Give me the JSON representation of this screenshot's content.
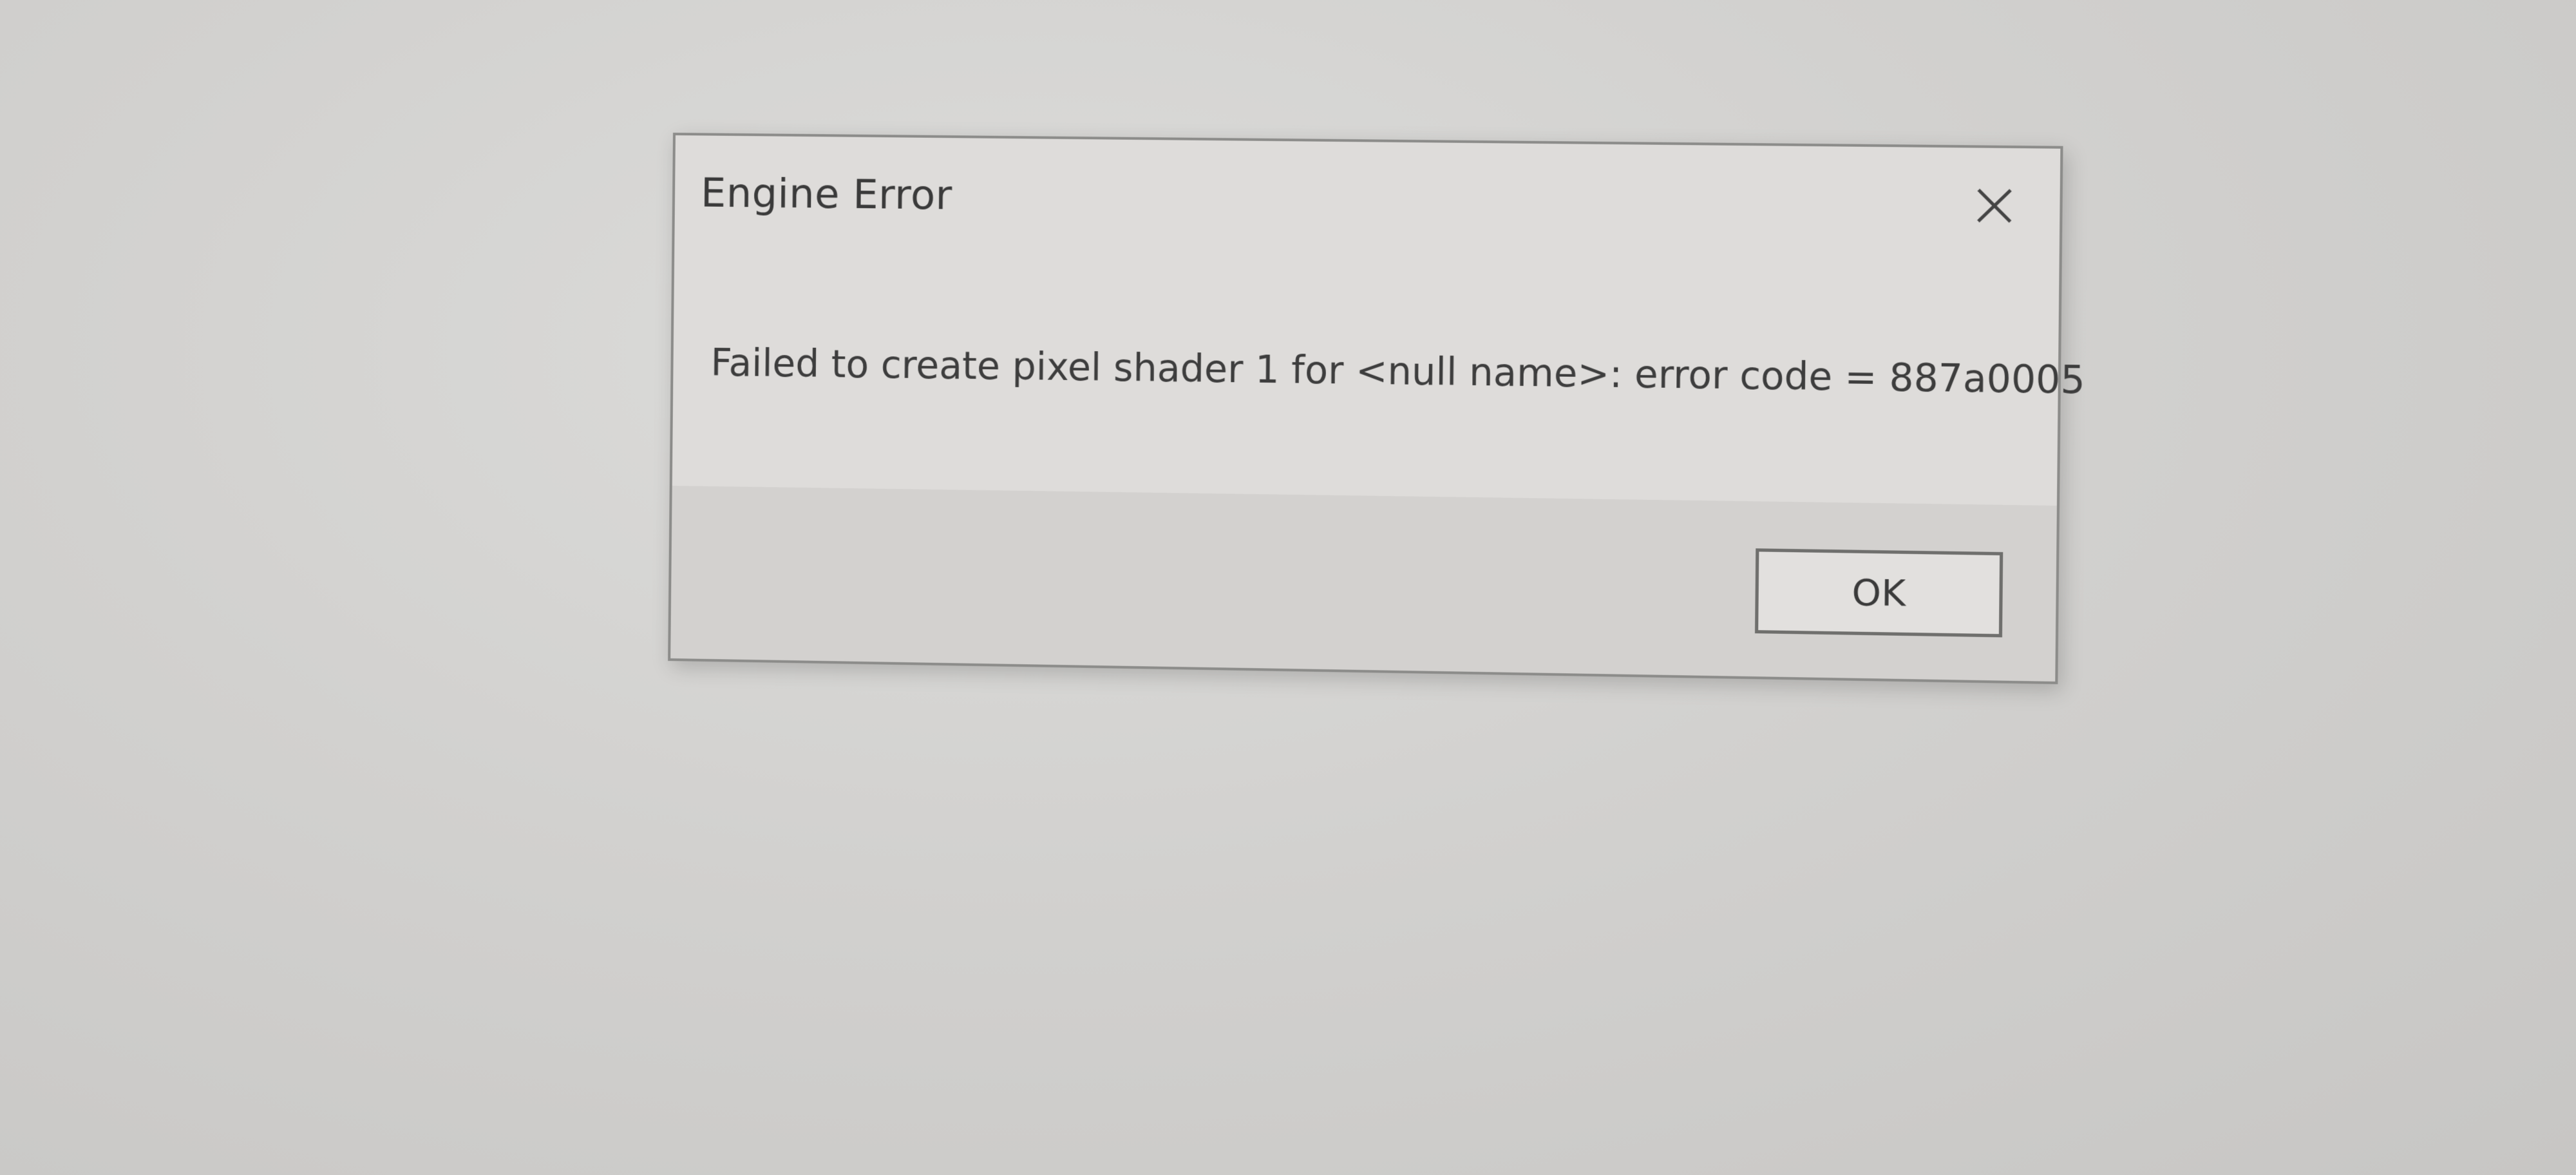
{
  "dialog": {
    "title": "Engine Error",
    "message": "Failed to create pixel shader 1 for <null name>: error code = 887a0005",
    "close_icon": "close-icon",
    "ok_label": "OK"
  },
  "colors": {
    "dialog_background": "#dedcda",
    "button_bar": "#d3d1cf",
    "border": "#8c8c8a",
    "text": "#3a3a3a"
  }
}
